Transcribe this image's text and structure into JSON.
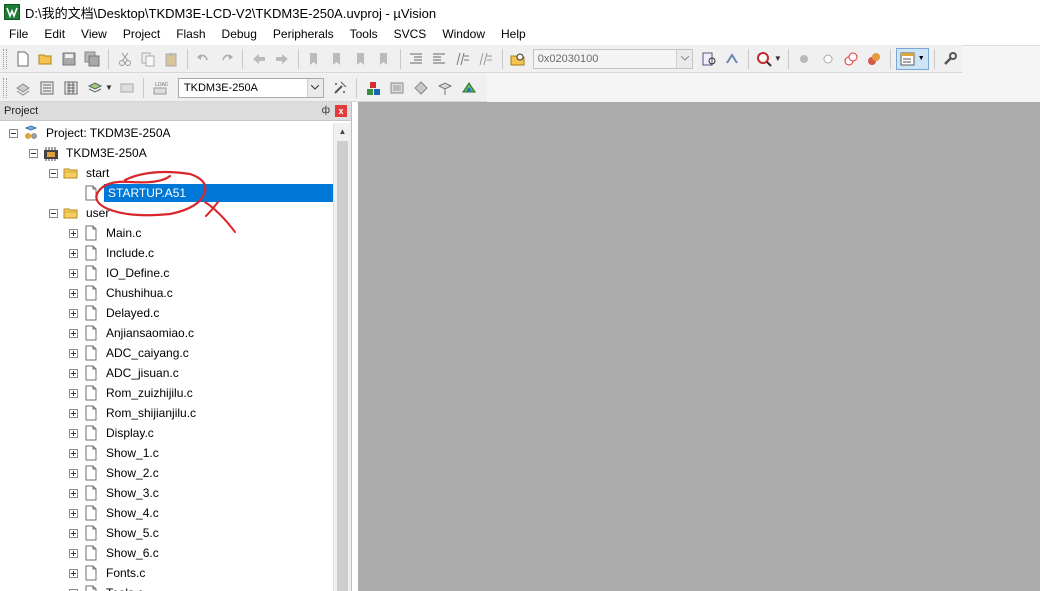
{
  "window": {
    "title": "D:\\我的文档\\Desktop\\TKDM3E-LCD-V2\\TKDM3E-250A.uvproj - µVision"
  },
  "menu": {
    "items": [
      "File",
      "Edit",
      "View",
      "Project",
      "Flash",
      "Debug",
      "Peripherals",
      "Tools",
      "SVCS",
      "Window",
      "Help"
    ]
  },
  "toolbar": {
    "address_value": "0x02030100",
    "target_value": "TKDM3E-250A"
  },
  "project_panel": {
    "title": "Project",
    "pin_glyph": "ф",
    "close_glyph": "x"
  },
  "tree": {
    "root_label": "Project: TKDM3E-250A",
    "target_label": "TKDM3E-250A",
    "groups": [
      {
        "name": "start",
        "files": [
          "STARTUP.A51"
        ]
      },
      {
        "name": "user",
        "files": [
          "Main.c",
          "Include.c",
          "IO_Define.c",
          "Chushihua.c",
          "Delayed.c",
          "Anjiansaomiao.c",
          "ADC_caiyang.c",
          "ADC_jisuan.c",
          "Rom_zuizhijilu.c",
          "Rom_shijianjilu.c",
          "Display.c",
          "Show_1.c",
          "Show_2.c",
          "Show_3.c",
          "Show_4.c",
          "Show_5.c",
          "Show_6.c",
          "Fonts.c",
          "Tools.c"
        ]
      }
    ],
    "selected_file": "STARTUP.A51"
  },
  "colors": {
    "selection": "#0078d7",
    "annotation": "#d9262c",
    "editor_bg": "#ababab"
  }
}
